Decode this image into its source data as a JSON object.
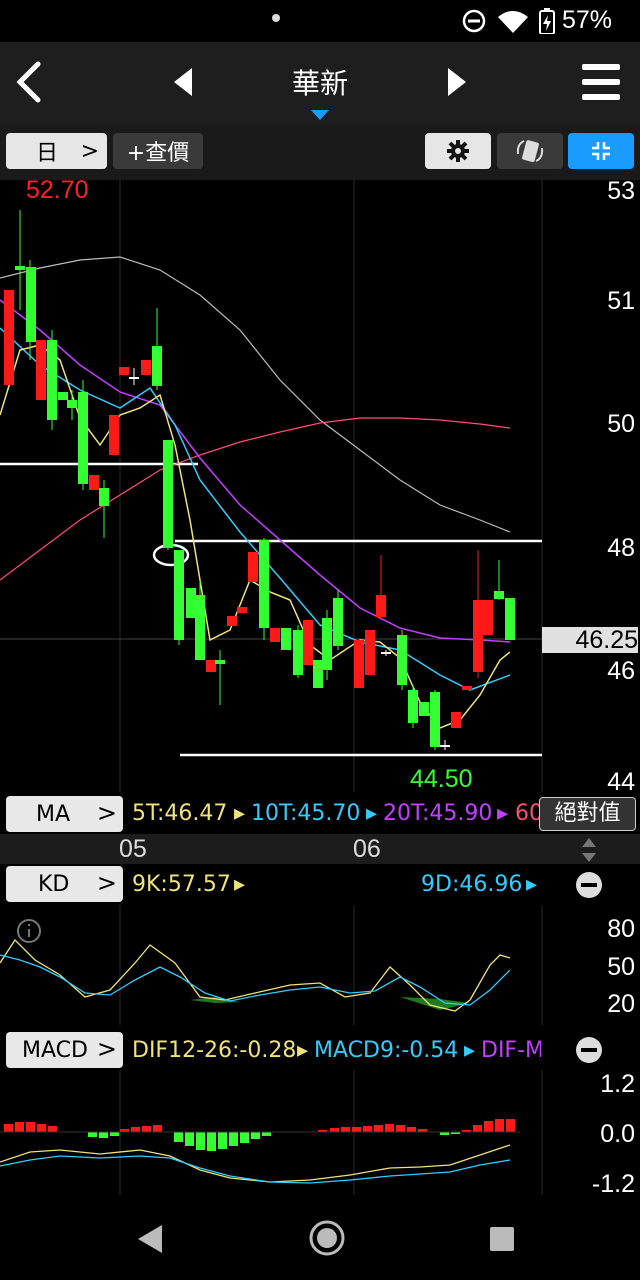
{
  "status": {
    "battery": "57%"
  },
  "header": {
    "title": "華新"
  },
  "toolbar": {
    "period_label": "日",
    "query_label": "+查價"
  },
  "price_chart": {
    "high_label": "52.70",
    "low_label": "44.50",
    "current_price": "46.25",
    "y_ticks": [
      "53",
      "51",
      "50",
      "48",
      "46",
      "44"
    ]
  },
  "ma_row": {
    "tag": "MA",
    "ma5": "5T:46.47",
    "ma10": "10T:45.70",
    "ma20": "20T:45.90",
    "ma60": "60",
    "abs_button": "絕對值"
  },
  "dates": [
    "05",
    "06"
  ],
  "kd_row": {
    "tag": "KD",
    "k": "9K:57.57",
    "d": "9D:46.96",
    "y_ticks": [
      "80",
      "50",
      "20"
    ]
  },
  "macd_row": {
    "tag": "MACD",
    "dif": "DIF12-26:-0.28",
    "macd": "MACD9:-0.54",
    "diff": "DIF-M",
    "y_ticks": [
      "1.2",
      "0.0",
      "-1.2"
    ]
  },
  "colors": {
    "up": "#ff1a1a",
    "down": "#33ff33",
    "ma5": "#f0e27a",
    "ma10": "#33ccff",
    "ma20": "#c040ff",
    "ma60": "#ff4d7a",
    "ma120": "#cccccc",
    "accent": "#1a9cff"
  },
  "icons": [
    "back-icon",
    "prev-stock-icon",
    "next-stock-icon",
    "menu-icon",
    "settings-icon",
    "rotate-icon",
    "fullscreen-icon",
    "info-icon",
    "collapse-icon"
  ]
}
